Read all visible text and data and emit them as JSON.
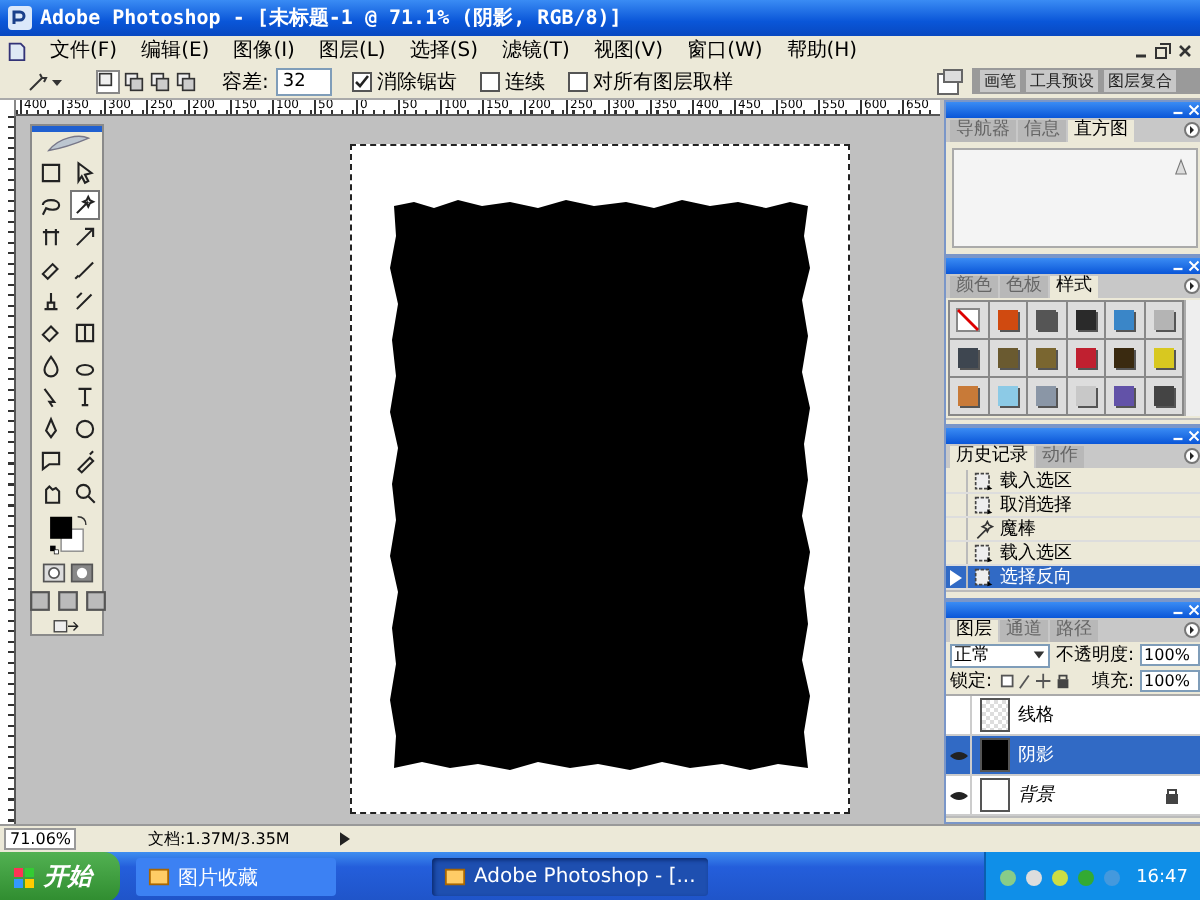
{
  "window": {
    "title": "Adobe Photoshop - [未标题-1 @ 71.1% (阴影, RGB/8)]"
  },
  "menu": [
    "文件(F)",
    "编辑(E)",
    "图像(I)",
    "图层(L)",
    "选择(S)",
    "滤镜(T)",
    "视图(V)",
    "窗口(W)",
    "帮助(H)"
  ],
  "options": {
    "modes": [
      {
        "selected": true
      },
      {
        "selected": false
      },
      {
        "selected": false
      },
      {
        "selected": false
      }
    ],
    "tolerance_label": "容差:",
    "tolerance": "32",
    "checkboxes": [
      {
        "label": "消除锯齿",
        "checked": true
      },
      {
        "label": "连续",
        "checked": false
      },
      {
        "label": "对所有图层取样",
        "checked": false
      }
    ],
    "palette_well": [
      "画笔",
      "工具预设",
      "图层复合"
    ]
  },
  "ruler": {
    "labels": [
      "400",
      "350",
      "300",
      "250",
      "200",
      "150",
      "100",
      "50",
      "0",
      "50",
      "100",
      "150",
      "200",
      "250",
      "300",
      "350",
      "400",
      "450",
      "500",
      "550",
      "600",
      "650"
    ]
  },
  "toolbox": {
    "tools": [
      {
        "selected": false
      },
      {
        "selected": false
      },
      {
        "selected": false
      },
      {
        "selected": true
      },
      {
        "selected": false
      },
      {
        "selected": false
      },
      {
        "selected": false
      },
      {
        "selected": false
      },
      {
        "selected": false
      },
      {
        "selected": false
      },
      {
        "selected": false
      },
      {
        "selected": false
      },
      {
        "selected": false
      },
      {
        "selected": false
      },
      {
        "selected": false
      },
      {
        "selected": false
      },
      {
        "selected": false
      },
      {
        "selected": false
      },
      {
        "selected": false
      },
      {
        "selected": false
      },
      {
        "selected": false
      },
      {
        "selected": false
      }
    ]
  },
  "navigator_panel": {
    "tabs": [
      {
        "label": "导航器",
        "selected": false
      },
      {
        "label": "信息",
        "selected": false
      },
      {
        "label": "直方图",
        "selected": true
      }
    ]
  },
  "styles_panel": {
    "tabs": [
      {
        "label": "颜色",
        "selected": false
      },
      {
        "label": "色板",
        "selected": false
      },
      {
        "label": "样式",
        "selected": true
      }
    ],
    "styles": [
      {
        "kind": "none",
        "color": "#ffffff"
      },
      {
        "kind": "swatch",
        "color": "#d04a10"
      },
      {
        "kind": "swatch",
        "color": "#555555"
      },
      {
        "kind": "swatch",
        "color": "#2a2a2a"
      },
      {
        "kind": "swatch",
        "color": "#3a86c8"
      },
      {
        "kind": "swatch",
        "color": "#b4b4b4"
      },
      {
        "kind": "swatch",
        "color": "#3e4650"
      },
      {
        "kind": "swatch",
        "color": "#6a5a30"
      },
      {
        "kind": "swatch",
        "color": "#7a6630"
      },
      {
        "kind": "swatch",
        "color": "#c02030"
      },
      {
        "kind": "swatch",
        "color": "#3a2a10"
      },
      {
        "kind": "swatch",
        "color": "#d8c820"
      },
      {
        "kind": "swatch",
        "color": "#c87a38"
      },
      {
        "kind": "swatch",
        "color": "#8ccae6"
      },
      {
        "kind": "swatch",
        "color": "#8a96a6"
      },
      {
        "kind": "swatch",
        "color": "#c8c8c8"
      },
      {
        "kind": "swatch",
        "color": "#6252a8"
      },
      {
        "kind": "swatch",
        "color": "#444444"
      }
    ]
  },
  "history_panel": {
    "tabs": [
      {
        "label": "历史记录",
        "selected": true
      },
      {
        "label": "动作",
        "selected": false
      }
    ],
    "items": [
      {
        "label": "载入选区",
        "kind": "selection",
        "selected": false
      },
      {
        "label": "取消选择",
        "kind": "selection",
        "selected": false
      },
      {
        "label": "魔棒",
        "kind": "wand",
        "selected": false
      },
      {
        "label": "载入选区",
        "kind": "selection",
        "selected": false
      },
      {
        "label": "选择反向",
        "kind": "selection",
        "selected": true
      }
    ]
  },
  "layers_panel": {
    "tabs": [
      {
        "label": "图层",
        "selected": true
      },
      {
        "label": "通道",
        "selected": false
      },
      {
        "label": "路径",
        "selected": false
      }
    ],
    "blend_mode": "正常",
    "opacity_label": "不透明度:",
    "opacity": "100%",
    "lock_label": "锁定:",
    "fill_label": "填充:",
    "fill": "100%",
    "layers": [
      {
        "name": "线格",
        "kind": "transparent",
        "visible": false,
        "selected": false
      },
      {
        "name": "阴影",
        "kind": "solid",
        "visible": true,
        "selected": true
      },
      {
        "name": "背景",
        "kind": "background",
        "visible": true,
        "selected": false
      }
    ]
  },
  "status_bar": {
    "zoom": "71.06%",
    "doc_info": "文档:1.37M/3.35M"
  },
  "taskbar": {
    "start": "开始",
    "tasks": [
      {
        "label": "图片收藏",
        "selected": false
      },
      {
        "label": "Adobe Photoshop - [...",
        "selected": true
      }
    ],
    "clock": "16:47"
  }
}
